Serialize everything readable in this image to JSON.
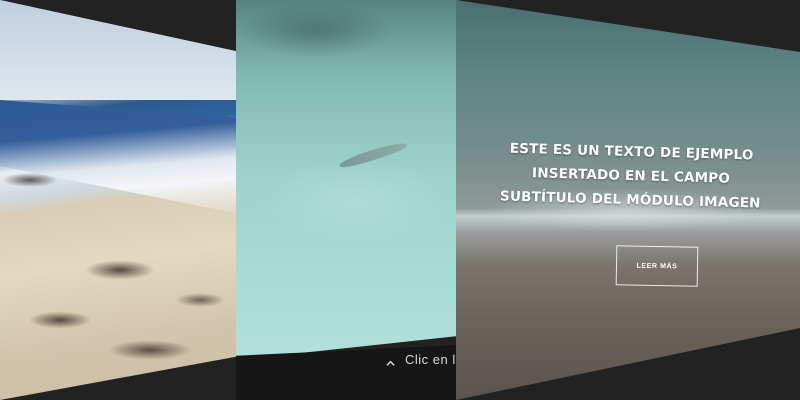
{
  "slides": [
    {
      "id": "beach",
      "image_subject": "beach-with-seaweed"
    },
    {
      "id": "water",
      "image_subject": "clear-water-with-shark",
      "bar_icon": "chevron-up-icon",
      "bar_text": "Clic en la"
    },
    {
      "id": "wave",
      "image_subject": "ocean-wave-on-sand",
      "title_line1": "ESTE ES UN TEXTO DE EJEMPLO INSERTADO EN EL CAMPO",
      "title_line2": "SUBTÍTULO DEL MÓDULO IMAGEN",
      "button_label": "LEER MÁS"
    }
  ],
  "colors": {
    "background": "#222222",
    "bar": "#161616",
    "text": "#ffffff"
  }
}
